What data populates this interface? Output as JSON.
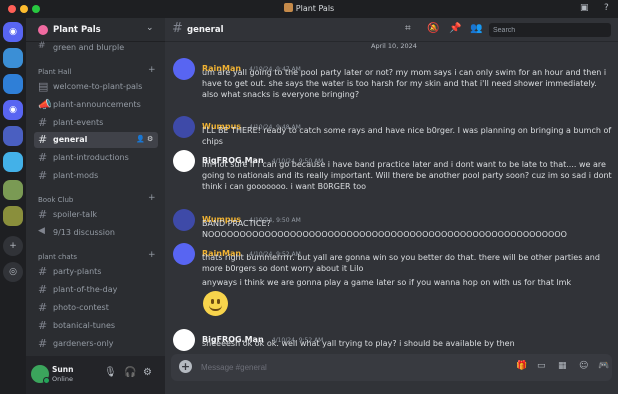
{
  "window": {
    "title": "Plant Pals"
  },
  "colors": {
    "accent": "#5865f2",
    "online": "#23a55a",
    "author_pink": "#f0b232",
    "author_white": "#f2f3f5"
  },
  "server": {
    "name": "Plant Pals"
  },
  "sidebar": {
    "top_partial": "green and blurple",
    "categories": [
      {
        "name": "Plant Hall",
        "channels": [
          "welcome-to-plant-pals",
          "plant-announcements",
          "plant-events",
          "general",
          "plant-introductions",
          "plant-mods"
        ]
      },
      {
        "name": "Book Club",
        "channels": [
          "spoiler-talk",
          "9/13 discussion"
        ]
      },
      {
        "name": "plant chats",
        "channels": [
          "party-plants",
          "plant-of-the-day",
          "photo-contest",
          "botanical-tunes",
          "gardeners-only"
        ]
      }
    ],
    "active_channel": "general"
  },
  "user": {
    "name": "Sunn",
    "status": "Online"
  },
  "channel": {
    "name": "general",
    "search_placeholder": "Search"
  },
  "date_divider": "April 10, 2024",
  "messages": [
    {
      "author": "RainMan",
      "time": "4/10/24, 9:47 AM",
      "color": "#f0b232",
      "text": "um are yall going to the pool party later or not? my mom says i can only swim for an hour and then i have to get out. she says the water is too harsh for my skin and that i'll need shower immediately. also what snacks is everyone bringing?"
    },
    {
      "author": "Wumpus",
      "time": "4/10/24, 9:48 AM",
      "color": "#f0b232",
      "text": "I'LL BE THERE! ready to catch some rays and have nice b0rger. I was planning on bringing a bumch of chips"
    },
    {
      "author": "BigFROG.Man",
      "time": "4/10/24, 9:50 AM",
      "color": "#f2f3f5",
      "text": "im not sure if i can go because i have band practice later and i dont want to be late to that.... we are going to nationals and its really important. Will there be another pool party soon? cuz im so sad i dont think i can gooooooo. i want B0RGER too"
    },
    {
      "author": "Wumpus",
      "time": "4/10/24, 9:50 AM",
      "color": "#f0b232",
      "text": "BAND PRACTICE? NOOOOOOOOOOOOOOOOOOOOOOOOOOOOOOOOOOOOOOOOOOOOOOOOOOOOOOOOO"
    },
    {
      "author": "RainMan",
      "time": "4/10/24, 9:52 AM",
      "color": "#f0b232",
      "text": "thats right bummerrrrr. but yall are gonna win so you better do that. there will be other parties and more b0rgers so dont worry about it Lilo",
      "followups": [
        "anyways i think we are gonna play a game later so if you wanna hop on with us for that lmk"
      ]
    },
    {
      "author": "BigFROG.Man",
      "time": "4/10/24, 9:52 AM",
      "color": "#f2f3f5",
      "text": "sheeeesh ok ok ok. well what yall trying to play? i should be available by then"
    }
  ],
  "composer": {
    "placeholder": "Message #general"
  }
}
